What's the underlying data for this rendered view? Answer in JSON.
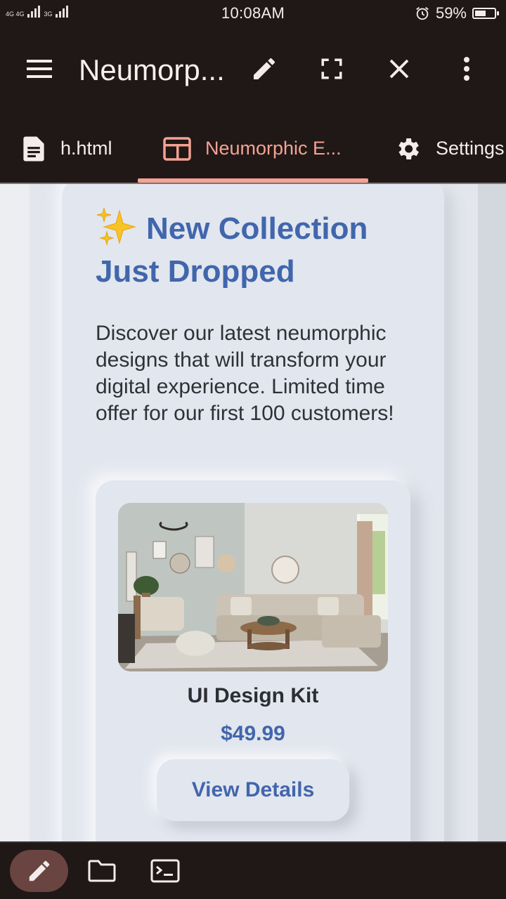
{
  "status_bar": {
    "network_1": "4G 4G",
    "network_2": "3G",
    "time": "10:08AM",
    "battery": "59%",
    "battery_level": 0.59
  },
  "app_bar": {
    "title": "Neumorp...",
    "icons": [
      "menu-icon",
      "edit-icon",
      "fullscreen-icon",
      "close-icon",
      "more-vert-icon"
    ]
  },
  "tabs": [
    {
      "label": "h.html",
      "icon": "file-icon",
      "active": false
    },
    {
      "label": "Neumorphic E...",
      "icon": "layout-icon",
      "active": true
    },
    {
      "label": "Settings",
      "icon": "gear-icon",
      "active": false
    }
  ],
  "page": {
    "headline_emoji": "sparkles",
    "headline": "New Collection Just Dropped",
    "description": "Discover our latest neumorphic designs that will transform your digital experience. Limited time offer for our first 100 customers!",
    "product": {
      "image": "living-room-photo",
      "name": "UI Design Kit",
      "price": "$49.99",
      "button": "View Details"
    }
  },
  "bottom_bar": {
    "icons": [
      "edit-icon",
      "folder-icon",
      "terminal-icon"
    ]
  },
  "colors": {
    "accent": "#4166ac",
    "tab_active": "#f4a293",
    "chrome_bg": "#1f1816",
    "surface": "#e2e6ee"
  }
}
